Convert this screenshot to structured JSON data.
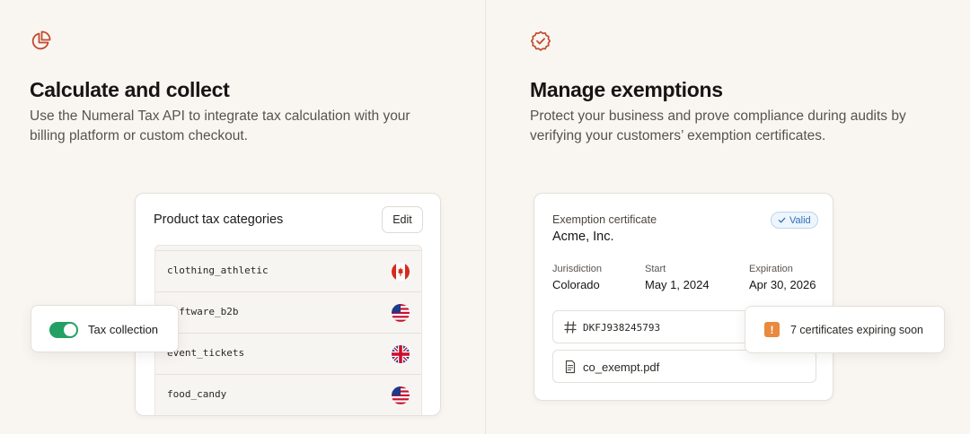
{
  "colors": {
    "accent": "#c24a2c",
    "toggle_on": "#23a063",
    "valid_blue": "#2f6fbc",
    "warning": "#e98a3d"
  },
  "left": {
    "icon": "pie-chart-icon",
    "title": "Calculate and collect",
    "description": "Use the Numeral Tax API to integrate tax calculation with your billing platform or custom checkout.",
    "tax_card": {
      "title": "Product tax categories",
      "edit_label": "Edit",
      "rows": [
        {
          "name": "clothing_athletic",
          "flag": "canada-flag-icon"
        },
        {
          "name": "software_b2b",
          "flag": "usa-flag-icon"
        },
        {
          "name": "event_tickets",
          "flag": "uk-flag-icon"
        },
        {
          "name": "food_candy",
          "flag": "usa-flag-icon"
        }
      ]
    },
    "toggle": {
      "label": "Tax collection",
      "on": true
    }
  },
  "right": {
    "icon": "badge-check-icon",
    "title": "Manage exemptions",
    "description": "Protect your business and prove compliance during audits by verifying your customers’ exemption certificates.",
    "certificate": {
      "label": "Exemption certificate",
      "company": "Acme, Inc.",
      "badge": "Valid",
      "fields": [
        {
          "label": "Jurisdiction",
          "value": "Colorado"
        },
        {
          "label": "Start",
          "value": "May 1, 2024"
        },
        {
          "label": "Expiration",
          "value": "Apr 30, 2026"
        }
      ],
      "id": "DKFJ938245793",
      "file": "co_exempt.pdf"
    },
    "expiring": {
      "icon_glyph": "!",
      "label": "7 certificates expiring soon"
    }
  }
}
